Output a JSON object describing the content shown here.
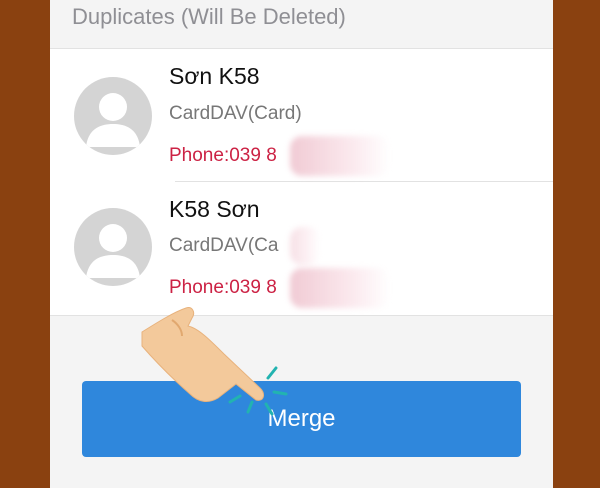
{
  "section_header": "Duplicates (Will Be Deleted)",
  "contacts": [
    {
      "name": "Sơn K58",
      "account": "CardDAV(Card)",
      "phone": "Phone:039 8"
    },
    {
      "name": "K58 Sơn",
      "account": "CardDAV(Ca",
      "phone": "Phone:039 8"
    }
  ],
  "merge_button": "Merge",
  "colors": {
    "frame": "#8a4110",
    "phone_text": "#cc2244",
    "button": "#2f87dc",
    "background": "#f4f4f4"
  },
  "icons": [
    "avatar-placeholder-icon",
    "pointing-hand-icon"
  ]
}
